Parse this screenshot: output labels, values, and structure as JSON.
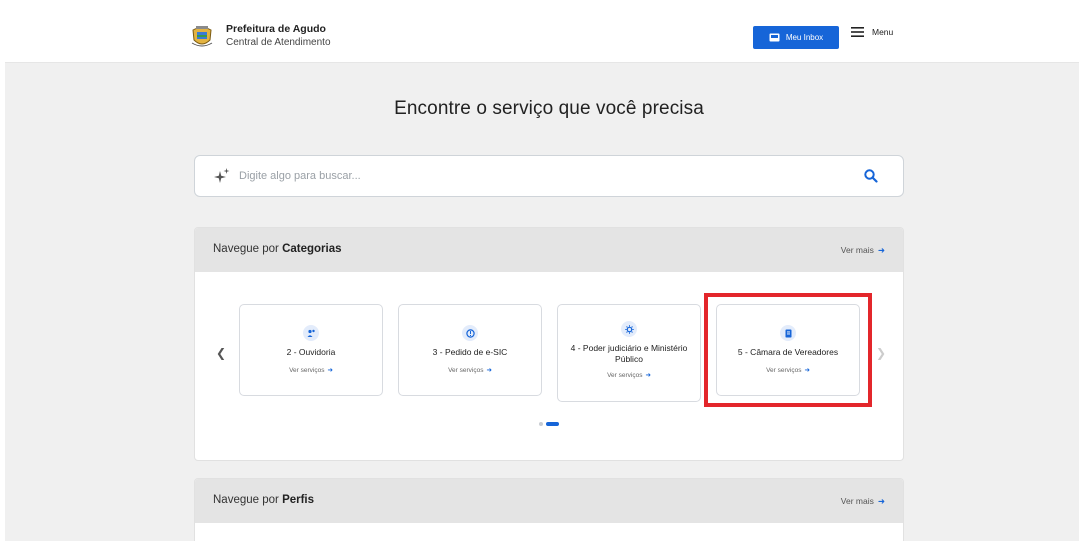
{
  "header": {
    "title": "Prefeitura de Agudo",
    "subtitle": "Central de Atendimento",
    "inbox_label": "Meu Inbox",
    "menu_label": "Menu"
  },
  "hero": {
    "title": "Encontre o serviço que você precisa"
  },
  "search": {
    "placeholder": "Digite algo para buscar..."
  },
  "categories": {
    "title_prefix": "Navegue por",
    "title_bold": "Categorias",
    "more": "Ver mais",
    "cards": [
      {
        "icon": "people-icon",
        "title": "2 - Ouvidoria",
        "link": "Ver serviços"
      },
      {
        "icon": "info-icon",
        "title": "3 - Pedido de e-SIC",
        "link": "Ver serviços"
      },
      {
        "icon": "gear-icon",
        "title": "4 - Poder judiciário e Ministério Público",
        "link": "Ver serviços"
      },
      {
        "icon": "document-icon",
        "title": "5 - Câmara de Vereadores",
        "link": "Ver serviços"
      }
    ],
    "pagination": {
      "pages": 2,
      "current": 2
    }
  },
  "profiles": {
    "title_prefix": "Navegue por",
    "title_bold": "Perfis",
    "more": "Ver mais"
  },
  "colors": {
    "accent": "#1665d8",
    "highlight": "#e3262b",
    "background": "#f0f0f0"
  }
}
